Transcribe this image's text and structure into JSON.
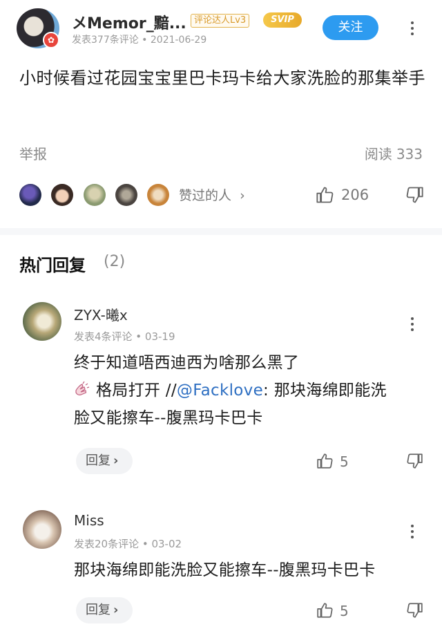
{
  "post": {
    "username": "メMemor_黯...",
    "level_badge": "评论达人Lv3",
    "vip_badge": "SVIP",
    "meta": "发表377条评论 • 2021-06-29",
    "follow_label": "关注",
    "content": "小时候看过花园宝宝里巴卡玛卡给大家洗脸的那集举手",
    "report_label": "举报",
    "read_label": "阅读",
    "read_count": "333",
    "likers_label": "赞过的人",
    "likers_chevron": "›",
    "like_count": "206"
  },
  "hot_replies": {
    "title": "热门回复",
    "count": "(2)"
  },
  "comments": [
    {
      "name": "ZYX-曦x",
      "meta": "发表4条评论 • 03-19",
      "line1": "终于知道唔西迪西为啥那么黑了",
      "line2_prefix": "格局打开 //",
      "mention": "@Facklove",
      "line2_suffix": ": 那块海绵即能洗",
      "line3": "脸又能擦车--腹黑玛卡巴卡",
      "reply_label": "回复",
      "like_count": "5"
    },
    {
      "name": "Miss",
      "meta": "发表20条评论 • 03-02",
      "line1": "那块海绵即能洗脸又能擦车--腹黑玛卡巴卡",
      "reply_label": "回复",
      "like_count": "5"
    }
  ],
  "icons": {
    "more": "more-vertical-icon",
    "like": "thumbs-up-icon",
    "dislike": "thumbs-down-icon",
    "chevron": "chevron-right-icon",
    "hands": "clapping-hands-icon"
  },
  "colors": {
    "accent": "#2d9bf0",
    "mention": "#2e6fc2",
    "vip": "#e7a92a",
    "muted_text": "#9a9a9a"
  }
}
